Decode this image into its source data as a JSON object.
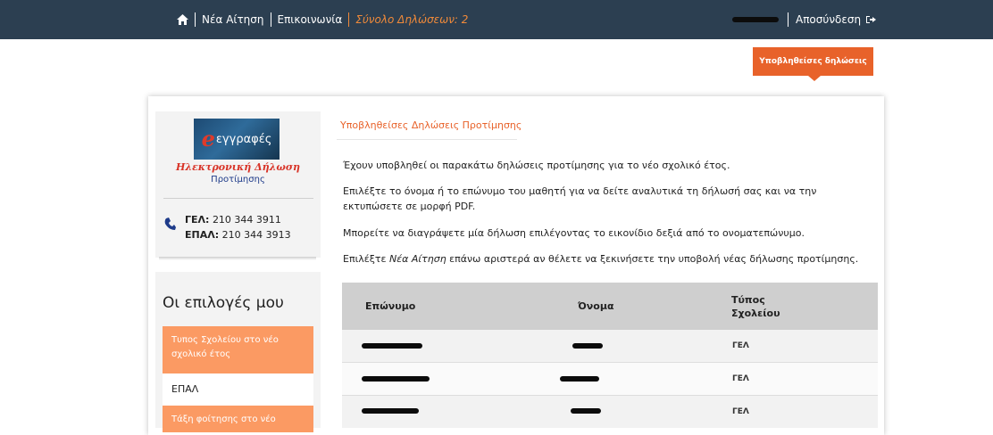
{
  "nav": {
    "new_application": "Νέα Αίτηση",
    "contact": "Επικοινωνία",
    "total_declarations": "Σύνολο Δηλώσεων: 2",
    "logout": "Αποσύνδεση"
  },
  "subnav": {
    "submitted": "Υποβληθείσες δηλώσεις"
  },
  "logo": {
    "line1": "Ηλεκτρονική Δήλωση",
    "line2": "Προτίμησης",
    "word": "εγγραφές"
  },
  "contact": {
    "gel_label": "ΓΕΛ:",
    "gel_phone": "210 344 3911",
    "epal_label": "ΕΠΑΛ:",
    "epal_phone": "210 344 3913"
  },
  "options": {
    "title": "Οι επιλογές μου",
    "school_type_label": "Τυπος Σχολείου στο νέο σχολικό έτος",
    "school_type_value": "ΕΠΑΛ",
    "class_label": "Τάξη φοίτησης στο νέο"
  },
  "main": {
    "title": "Υποβληθείσες Δηλώσεις Προτίμησης",
    "p1": "Έχουν υποβληθεί οι παρακάτω δηλώσεις προτίμησης για το νέο σχολικό έτος.",
    "p2": "Επιλέξτε το όνομα ή το επώνυμο του μαθητή για να δείτε αναλυτικά τη δήλωσή σας και να την εκτυπώσετε σε μορφή PDF.",
    "p3": "Μπορείτε να διαγράψετε μία δήλωση επιλέγοντας το εικονίδιο δεξιά από το ονοματεπώνυμο.",
    "p4_prefix": "Επιλέξτε ",
    "p4_em": "Νέα Αίτηση",
    "p4_suffix": " επάνω αριστερά αν θέλετε να ξεκινήσετε την υποβολή νέας δήλωσης προτίμησης."
  },
  "table": {
    "headers": {
      "surname": "Επώνυμο",
      "name": "Όνομα",
      "school_type_1": "Τύπος",
      "school_type_2": "Σχολείου"
    },
    "rows": [
      {
        "school_type": "ΓΕΛ"
      },
      {
        "school_type": "ΓΕΛ"
      },
      {
        "school_type": "ΓΕΛ"
      }
    ]
  },
  "colors": {
    "navbar": "#2c3f51",
    "accent": "#e8622a",
    "option_header": "#fb9a63"
  }
}
